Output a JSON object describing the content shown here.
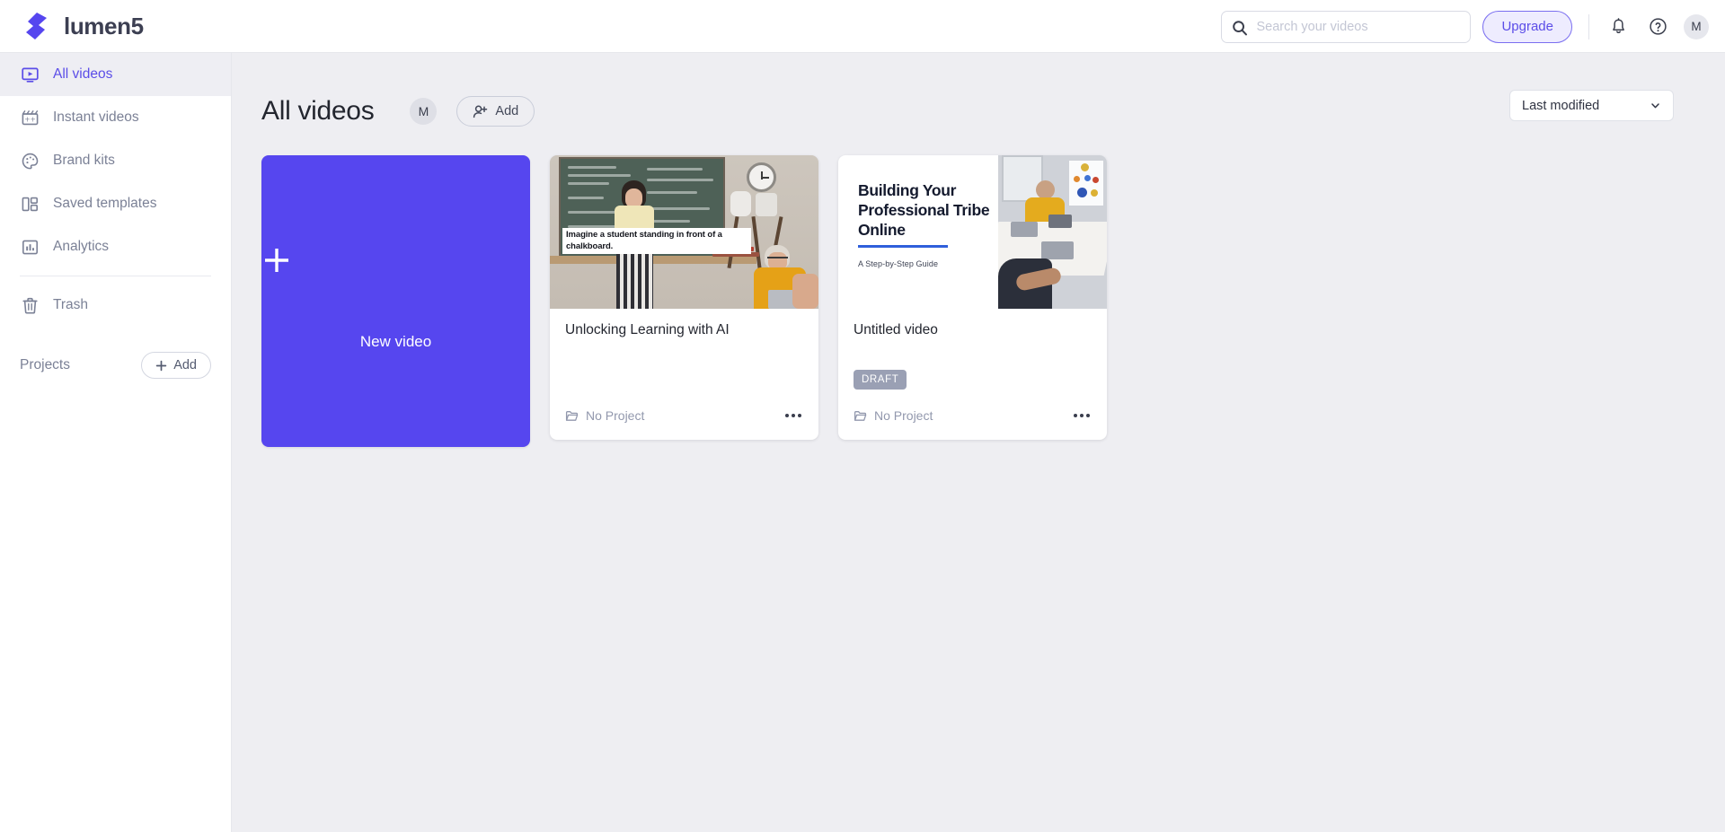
{
  "header": {
    "brand": "lumen5",
    "logo_icon": "lumen5-logo-icon",
    "search": {
      "placeholder": "Search your videos",
      "value": "",
      "icon": "search-icon"
    },
    "upgrade_label": "Upgrade",
    "notifications_icon": "bell-icon",
    "help_icon": "help-circle-icon",
    "avatar_initial": "M"
  },
  "sidebar": {
    "items": [
      {
        "label": "All videos",
        "icon": "video-monitor-icon",
        "active": true
      },
      {
        "label": "Instant videos",
        "icon": "clapperboard-icon",
        "active": false
      },
      {
        "label": "Brand kits",
        "icon": "palette-icon",
        "active": false
      },
      {
        "label": "Saved templates",
        "icon": "template-grid-icon",
        "active": false
      },
      {
        "label": "Analytics",
        "icon": "bar-chart-icon",
        "active": false
      },
      {
        "label": "Trash",
        "icon": "trash-icon",
        "active": false
      }
    ],
    "projects": {
      "label": "Projects",
      "add_label": "Add",
      "add_icon": "plus-icon"
    }
  },
  "main": {
    "page_title": "All videos",
    "avatar_initial": "M",
    "add_member_label": "Add",
    "add_member_icon": "person-plus-icon",
    "sort": {
      "value": "Last modified",
      "icon": "chevron-down-icon"
    },
    "new_video": {
      "label": "New video",
      "icon": "plus-icon"
    },
    "videos": [
      {
        "title": "Unlocking Learning with AI",
        "project": "No Project",
        "project_icon": "folder-icon",
        "menu_icon": "more-horizontal-icon",
        "status": "",
        "thumbnail_caption": "Imagine a student standing in front of a chalkboard.",
        "thumbnail_kind": "classroom-photo"
      },
      {
        "title": "Untitled video",
        "project": "No Project",
        "project_icon": "folder-icon",
        "menu_icon": "more-horizontal-icon",
        "status": "DRAFT",
        "thumbnail_title": "Building Your Professional Tribe Online",
        "thumbnail_subtitle": "A Step-by-Step Guide",
        "thumbnail_kind": "title-card-photo"
      }
    ]
  },
  "colors": {
    "brand_purple": "#5646ef",
    "accent_purple": "#5b4de8",
    "upgrade_bg": "#eeecfe",
    "canvas_bg": "#eeeef2",
    "draft_badge": "#9aa0b4",
    "muted_text": "#7b8196"
  }
}
